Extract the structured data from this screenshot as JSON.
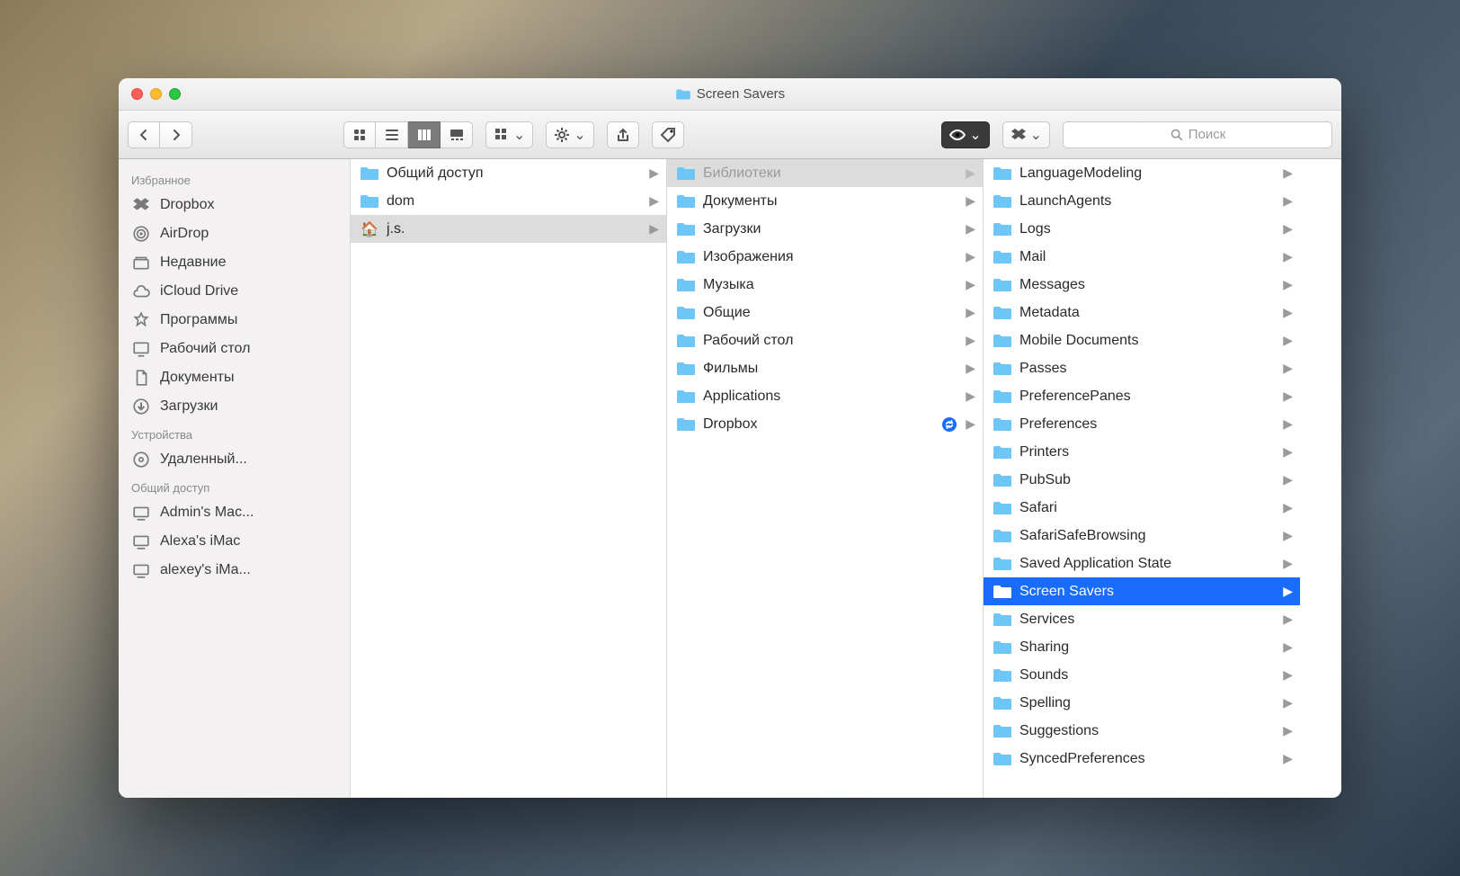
{
  "window": {
    "title": "Screen Savers"
  },
  "search": {
    "placeholder": "Поиск"
  },
  "sidebar": {
    "sections": [
      {
        "title": "Избранное",
        "items": [
          {
            "icon": "dropbox",
            "label": "Dropbox"
          },
          {
            "icon": "airdrop",
            "label": "AirDrop"
          },
          {
            "icon": "recents",
            "label": "Недавние"
          },
          {
            "icon": "icloud",
            "label": "iCloud Drive"
          },
          {
            "icon": "apps",
            "label": "Программы"
          },
          {
            "icon": "desktop",
            "label": "Рабочий стол"
          },
          {
            "icon": "docs",
            "label": "Документы"
          },
          {
            "icon": "downloads",
            "label": "Загрузки"
          }
        ]
      },
      {
        "title": "Устройства",
        "items": [
          {
            "icon": "disc",
            "label": "Удаленный..."
          }
        ]
      },
      {
        "title": "Общий доступ",
        "items": [
          {
            "icon": "computer",
            "label": "Admin's Mac..."
          },
          {
            "icon": "computer",
            "label": "Alexa's iMac"
          },
          {
            "icon": "computer",
            "label": "alexey's iMa..."
          }
        ]
      }
    ]
  },
  "columns": [
    {
      "items": [
        {
          "icon": "folder",
          "label": "Общий доступ",
          "arrow": true
        },
        {
          "icon": "folder",
          "label": "dom",
          "arrow": true
        },
        {
          "icon": "home",
          "label": "j.s.",
          "arrow": true,
          "state": "path"
        }
      ]
    },
    {
      "items": [
        {
          "icon": "folder",
          "label": "Библиотеки",
          "arrow": true,
          "state": "path-muted"
        },
        {
          "icon": "folder",
          "label": "Документы",
          "arrow": true
        },
        {
          "icon": "folder",
          "label": "Загрузки",
          "arrow": true
        },
        {
          "icon": "folder",
          "label": "Изображения",
          "arrow": true
        },
        {
          "icon": "folder",
          "label": "Музыка",
          "arrow": true
        },
        {
          "icon": "folder",
          "label": "Общие",
          "arrow": true
        },
        {
          "icon": "folder",
          "label": "Рабочий стол",
          "arrow": true
        },
        {
          "icon": "folder",
          "label": "Фильмы",
          "arrow": true
        },
        {
          "icon": "folder",
          "label": "Applications",
          "arrow": true
        },
        {
          "icon": "folder",
          "label": "Dropbox",
          "arrow": true,
          "sync": true
        }
      ]
    },
    {
      "items": [
        {
          "icon": "folder",
          "label": "LanguageModeling",
          "arrow": true
        },
        {
          "icon": "folder",
          "label": "LaunchAgents",
          "arrow": true
        },
        {
          "icon": "folder",
          "label": "Logs",
          "arrow": true
        },
        {
          "icon": "folder",
          "label": "Mail",
          "arrow": true
        },
        {
          "icon": "folder",
          "label": "Messages",
          "arrow": true
        },
        {
          "icon": "folder",
          "label": "Metadata",
          "arrow": true
        },
        {
          "icon": "folder",
          "label": "Mobile Documents",
          "arrow": true
        },
        {
          "icon": "folder",
          "label": "Passes",
          "arrow": true
        },
        {
          "icon": "folder",
          "label": "PreferencePanes",
          "arrow": true
        },
        {
          "icon": "folder",
          "label": "Preferences",
          "arrow": true
        },
        {
          "icon": "folder",
          "label": "Printers",
          "arrow": true
        },
        {
          "icon": "folder",
          "label": "PubSub",
          "arrow": true
        },
        {
          "icon": "folder",
          "label": "Safari",
          "arrow": true
        },
        {
          "icon": "folder",
          "label": "SafariSafeBrowsing",
          "arrow": true
        },
        {
          "icon": "folder",
          "label": "Saved Application State",
          "arrow": true
        },
        {
          "icon": "folder",
          "label": "Screen Savers",
          "arrow": true,
          "state": "selected"
        },
        {
          "icon": "folder",
          "label": "Services",
          "arrow": true
        },
        {
          "icon": "folder",
          "label": "Sharing",
          "arrow": true
        },
        {
          "icon": "folder",
          "label": "Sounds",
          "arrow": true
        },
        {
          "icon": "folder",
          "label": "Spelling",
          "arrow": true
        },
        {
          "icon": "folder",
          "label": "Suggestions",
          "arrow": true
        },
        {
          "icon": "folder",
          "label": "SyncedPreferences",
          "arrow": true
        }
      ]
    }
  ]
}
